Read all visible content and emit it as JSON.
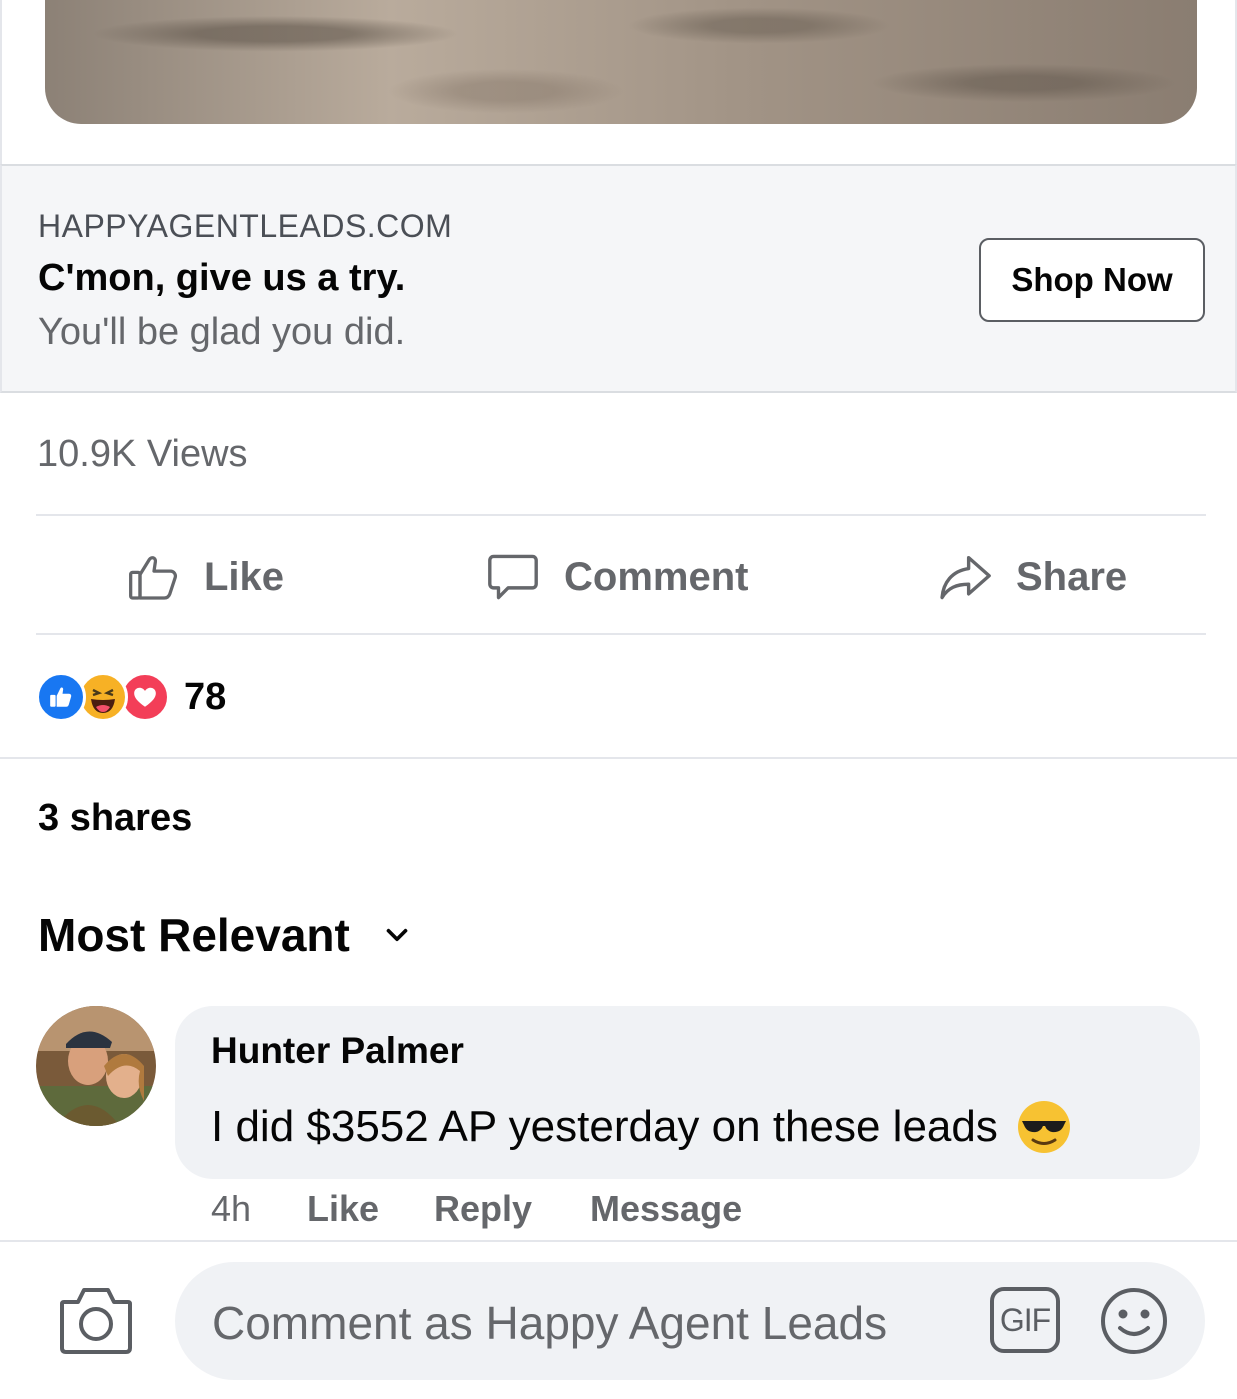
{
  "link_preview": {
    "domain": "HAPPYAGENTLEADS.COM",
    "headline": "C'mon, give us a try.",
    "description": "You'll be glad you did.",
    "cta_label": "Shop Now"
  },
  "stats": {
    "views": "10.9K Views",
    "reaction_count": "78",
    "shares": "3 shares"
  },
  "actions": {
    "like_label": "Like",
    "comment_label": "Comment",
    "share_label": "Share"
  },
  "comments_section": {
    "sort_label": "Most Relevant"
  },
  "comment": {
    "author": "Hunter Palmer",
    "text": "I did $3552 AP yesterday on these leads",
    "time": "4h",
    "like_label": "Like",
    "reply_label": "Reply",
    "message_label": "Message"
  },
  "composer": {
    "placeholder": "Comment as Happy Agent Leads",
    "gif_label": "GIF"
  },
  "colors": {
    "like_blue": "#1877f2",
    "love_red": "#f33e58",
    "haha_yellow": "#f7b125",
    "secondary_text": "#65676b"
  }
}
